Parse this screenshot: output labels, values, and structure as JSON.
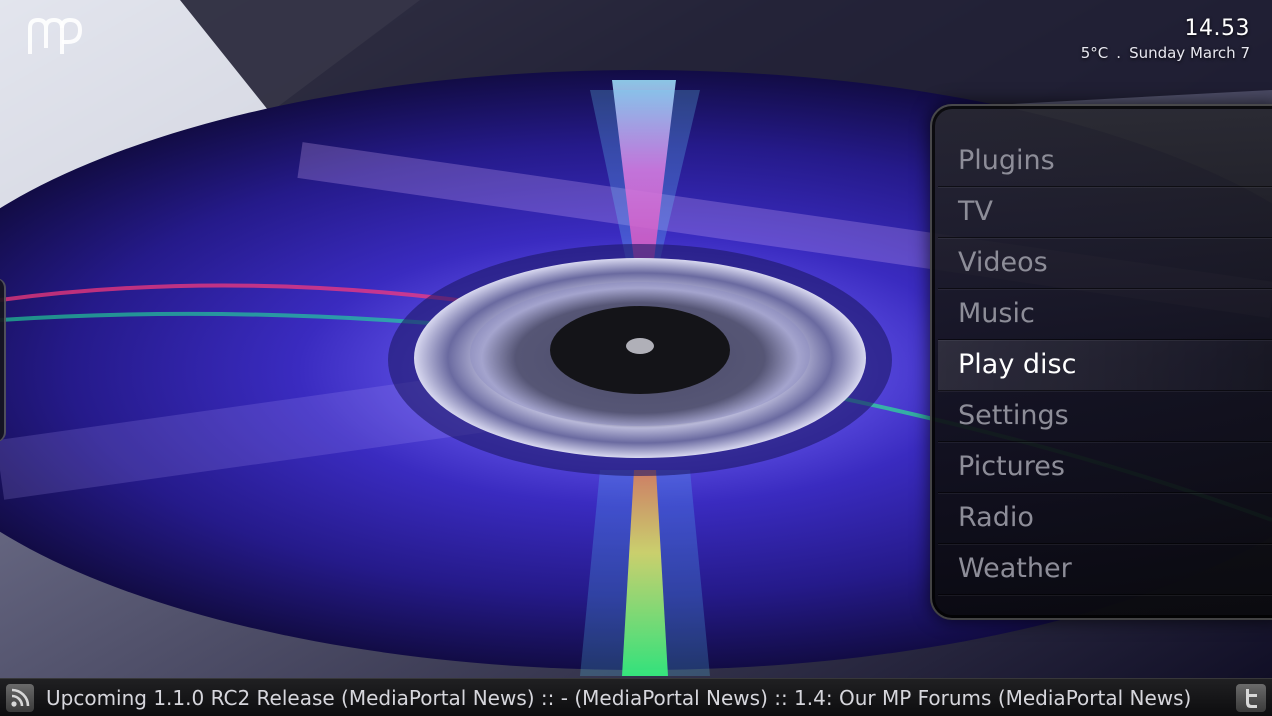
{
  "app": {
    "logo_text": "MP"
  },
  "header": {
    "time": "14.53",
    "temperature": "5°C",
    "separator": ".",
    "date": "Sunday March 7"
  },
  "menu": {
    "items": [
      {
        "label": "Plugins",
        "selected": false
      },
      {
        "label": "TV",
        "selected": false
      },
      {
        "label": "Videos",
        "selected": false
      },
      {
        "label": "Music",
        "selected": false
      },
      {
        "label": "Play disc",
        "selected": true
      },
      {
        "label": "Settings",
        "selected": false
      },
      {
        "label": "Pictures",
        "selected": false
      },
      {
        "label": "Radio",
        "selected": false
      },
      {
        "label": "Weather",
        "selected": false
      }
    ]
  },
  "ticker": {
    "text": "Upcoming 1.1.0 RC2 Release (MediaPortal News) :: - (MediaPortal News) :: 1.4: Our MP Forums (MediaPortal News)",
    "left_icon": "rss-icon",
    "right_icon": "twitter-icon"
  },
  "colors": {
    "menu_text": "#8d8d98",
    "menu_selected_text": "#ffffff",
    "disc_blue": "#3b2fc9"
  }
}
